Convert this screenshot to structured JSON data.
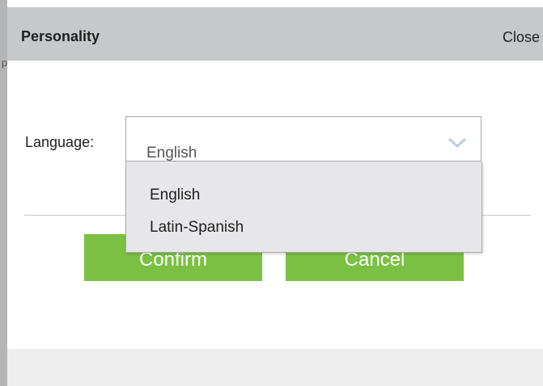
{
  "dialog": {
    "title": "Personality",
    "close_label": "Close"
  },
  "form": {
    "language_label": "Language:",
    "language_selected": "English",
    "language_options": [
      "English",
      "Latin-Spanish"
    ]
  },
  "buttons": {
    "confirm_label": "Confirm",
    "cancel_label": "Cancel"
  },
  "colors": {
    "header_bg": "#c7c8ca",
    "button_green": "#7ac143",
    "dropdown_bg": "#e7e7e9"
  },
  "icons": {
    "select_arrow": "chevron-down-icon"
  }
}
